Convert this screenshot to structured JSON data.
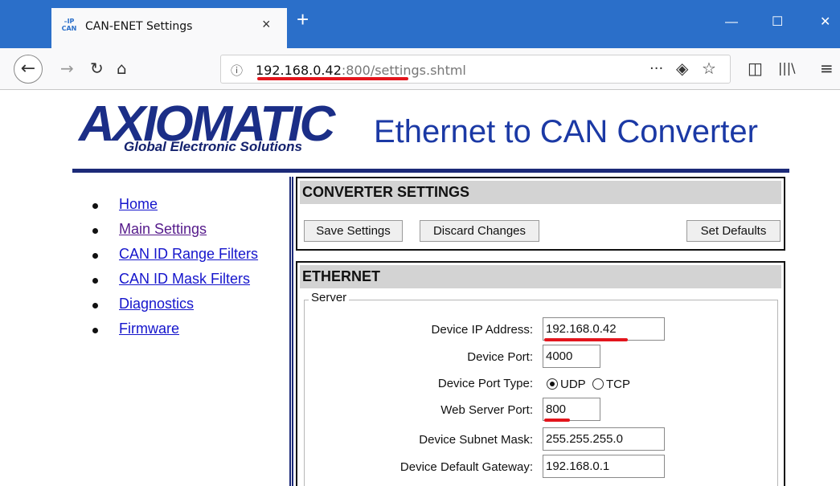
{
  "browser": {
    "tab_favicon": "CAN-IP",
    "tab_title": "CAN-ENET Settings",
    "tab_close": "×",
    "new_tab": "+",
    "win_min": "—",
    "win_max": "☐",
    "win_close": "✕",
    "url_host": "192.168.0.42",
    "url_port": ":800",
    "url_path": "/settings.shtml",
    "info_icon": "ⓘ",
    "back": "←",
    "forward": "→",
    "reload": "↻",
    "home": "⌂",
    "more": "···",
    "pocket": "◈",
    "star": "☆",
    "sidebar": "◫",
    "library": "|||\\",
    "menu": "≡"
  },
  "header": {
    "logo_text": "AXIOMATIC",
    "logo_tagline": "Global Electronic Solutions",
    "title": "Ethernet to CAN Converter"
  },
  "sidebar": {
    "items": [
      {
        "label": "Home"
      },
      {
        "label": "Main Settings"
      },
      {
        "label": "CAN ID Range Filters"
      },
      {
        "label": "CAN ID Mask Filters"
      },
      {
        "label": "Diagnostics"
      },
      {
        "label": "Firmware"
      }
    ]
  },
  "converter": {
    "heading": "CONVERTER SETTINGS",
    "save_label": "Save Settings",
    "discard_label": "Discard Changes",
    "defaults_label": "Set Defaults"
  },
  "ethernet": {
    "heading": "ETHERNET",
    "server_legend": "Server",
    "fields": {
      "ip_label": "Device IP Address:",
      "ip_value": "192.168.0.42",
      "port_label": "Device Port:",
      "port_value": "4000",
      "port_type_label": "Device Port Type:",
      "udp_label": "UDP",
      "tcp_label": "TCP",
      "web_port_label": "Web Server Port:",
      "web_port_value": "800",
      "mask_label": "Device Subnet Mask:",
      "mask_value": "255.255.255.0",
      "gateway_label": "Device Default Gateway:",
      "gateway_value": "192.168.0.1"
    }
  },
  "colors": {
    "browser_accent": "#2b6fc9",
    "brand_navy": "#1c2a78",
    "link": "#1515cc",
    "visited_link": "#551a8b",
    "highlight_red": "#e3151c"
  }
}
